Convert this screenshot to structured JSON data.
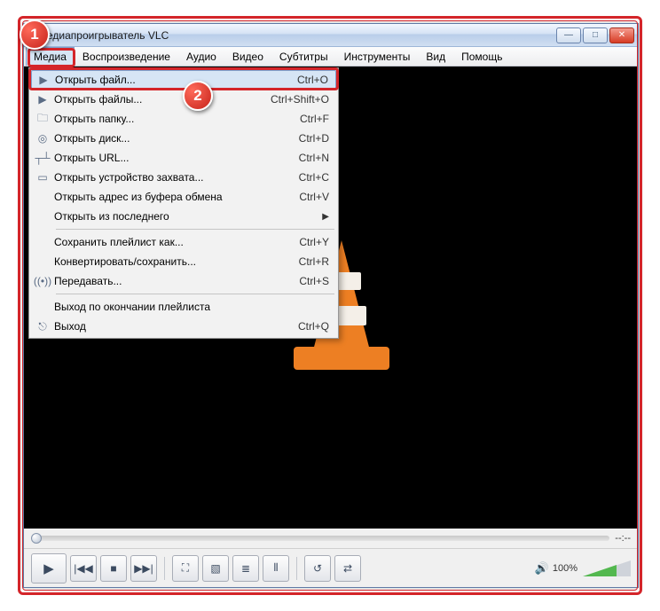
{
  "window": {
    "title": "едиапроигрыватель VLC"
  },
  "menubar": {
    "items": [
      "Медиа",
      "Воспроизведение",
      "Аудио",
      "Видео",
      "Субтитры",
      "Инструменты",
      "Вид",
      "Помощь"
    ]
  },
  "dropdown": [
    {
      "icon": "play-file",
      "label": "Открыть файл...",
      "shortcut": "Ctrl+O",
      "hi": true
    },
    {
      "icon": "play-files",
      "label": "Открыть файлы...",
      "shortcut": "Ctrl+Shift+O"
    },
    {
      "icon": "folder",
      "label": "Открыть папку...",
      "shortcut": "Ctrl+F"
    },
    {
      "icon": "disc",
      "label": "Открыть диск...",
      "shortcut": "Ctrl+D"
    },
    {
      "icon": "network",
      "label": "Открыть URL...",
      "shortcut": "Ctrl+N"
    },
    {
      "icon": "capture",
      "label": "Открыть устройство захвата...",
      "shortcut": "Ctrl+C"
    },
    {
      "icon": "",
      "label": "Открыть адрес из буфера обмена",
      "shortcut": "Ctrl+V"
    },
    {
      "icon": "",
      "label": "Открыть из последнего",
      "shortcut": "",
      "arrow": true
    },
    {
      "sep": true
    },
    {
      "icon": "",
      "label": "Сохранить плейлист как...",
      "shortcut": "Ctrl+Y"
    },
    {
      "icon": "",
      "label": "Конвертировать/сохранить...",
      "shortcut": "Ctrl+R"
    },
    {
      "icon": "stream",
      "label": "Передавать...",
      "shortcut": "Ctrl+S"
    },
    {
      "sep": true
    },
    {
      "icon": "",
      "label": "Выход по окончании плейлиста",
      "shortcut": ""
    },
    {
      "icon": "exit",
      "label": "Выход",
      "shortcut": "Ctrl+Q"
    }
  ],
  "slider": {
    "time": "--:--"
  },
  "volume": {
    "text": "100%"
  },
  "badges": {
    "one": "1",
    "two": "2"
  },
  "icons": {
    "play-file": "▶",
    "play-files": "▶",
    "folder": "🗀",
    "disc": "◎",
    "network": "┬┴",
    "capture": "▭",
    "stream": "((•))",
    "exit": "⎋",
    "play": "▶",
    "prev": "|◀◀",
    "stop": "■",
    "next": "▶▶|",
    "full": "⛶",
    "ext": "▧",
    "list": "≣",
    "eq": "⫴",
    "loop": "↺",
    "shuf": "⇄",
    "speaker": "🔊",
    "min": "—",
    "max": "□",
    "close": "✕"
  }
}
